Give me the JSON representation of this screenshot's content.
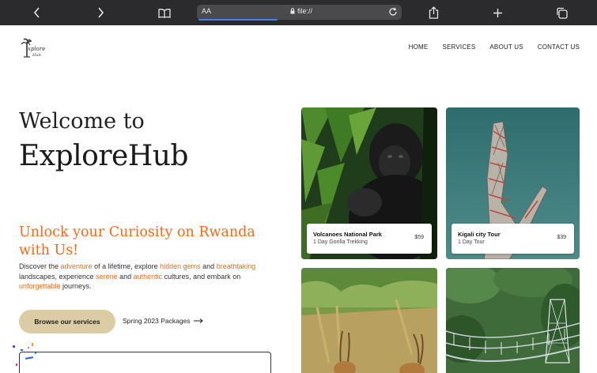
{
  "browser": {
    "aa_label": "AA",
    "url": "file://"
  },
  "nav": {
    "items": [
      "HOME",
      "SERVICES",
      "ABOUT US",
      "CONTACT US"
    ]
  },
  "hero": {
    "welcome": "Welcome to",
    "brand": "ExploreHub",
    "tagline": "Unlock your Curiosity on Rwanda with Us!",
    "description_parts": [
      {
        "text": "Discover the ",
        "hl": false
      },
      {
        "text": "adventure",
        "hl": true
      },
      {
        "text": " of a lifetime, explore ",
        "hl": false
      },
      {
        "text": "hidden gems",
        "hl": true
      },
      {
        "text": " and ",
        "hl": false
      },
      {
        "text": "breathtaking",
        "hl": true
      },
      {
        "text": " landscapes, experience ",
        "hl": false
      },
      {
        "text": "serene",
        "hl": true
      },
      {
        "text": " and ",
        "hl": false
      },
      {
        "text": "authentic",
        "hl": true
      },
      {
        "text": " cultures, and embark on ",
        "hl": false
      },
      {
        "text": "unforgettable",
        "hl": true
      },
      {
        "text": " journeys.",
        "hl": false
      }
    ],
    "primary_button": "Browse our services",
    "secondary_link": "Spring 2023 Packages"
  },
  "cards": [
    {
      "title": "Volcanoes National Park",
      "subtitle": "1 Day Gorilla Trekking",
      "price": "$59"
    },
    {
      "title": "Kigali city Tour",
      "subtitle": "1 Day Tour",
      "price": "$39"
    }
  ],
  "colors": {
    "accent": "#f26b1d",
    "button_bg": "#dccca6",
    "toolbar": "#2b2b2d"
  }
}
